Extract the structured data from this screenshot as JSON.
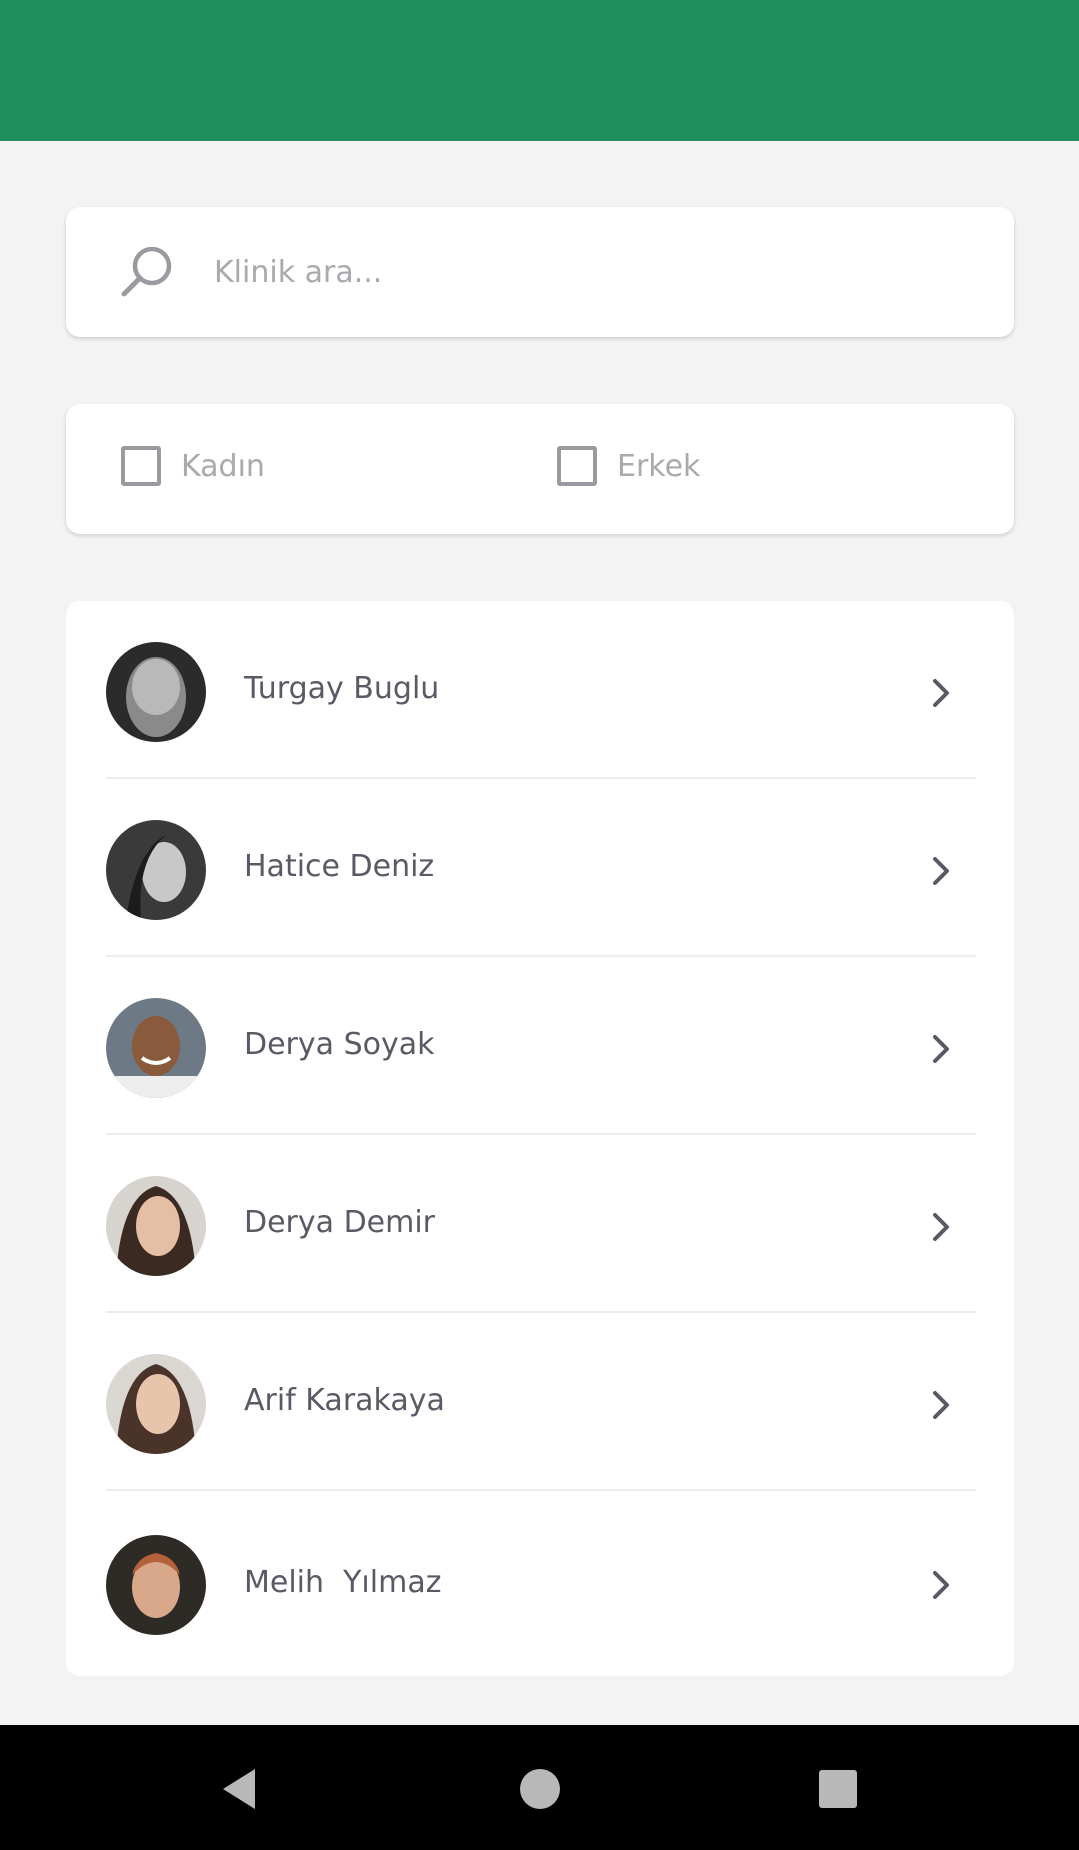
{
  "app_bar": {
    "color": "#1f8e5e"
  },
  "search": {
    "placeholder": "Klinik ara...",
    "icon": "search-icon"
  },
  "filters": {
    "female_label": "Kadın",
    "male_label": "Erkek",
    "female_checked": false,
    "male_checked": false
  },
  "doctors": [
    {
      "name": "Turgay Buglu",
      "avatar_icon": "avatar-icon"
    },
    {
      "name": "Hatice Deniz",
      "avatar_icon": "avatar-icon"
    },
    {
      "name": "Derya Soyak",
      "avatar_icon": "avatar-icon"
    },
    {
      "name": "Derya Demir",
      "avatar_icon": "avatar-icon"
    },
    {
      "name": "Arif Karakaya",
      "avatar_icon": "avatar-icon"
    },
    {
      "name": "Melih  Yılmaz",
      "avatar_icon": "avatar-icon"
    }
  ],
  "nav": {
    "back_icon": "back-triangle-icon",
    "home_icon": "home-circle-icon",
    "recents_icon": "recents-square-icon"
  },
  "colors": {
    "accent": "#1f8e5e",
    "background": "#f3f3f3",
    "text": "#5a5a66",
    "placeholder": "#a9a9ae"
  }
}
